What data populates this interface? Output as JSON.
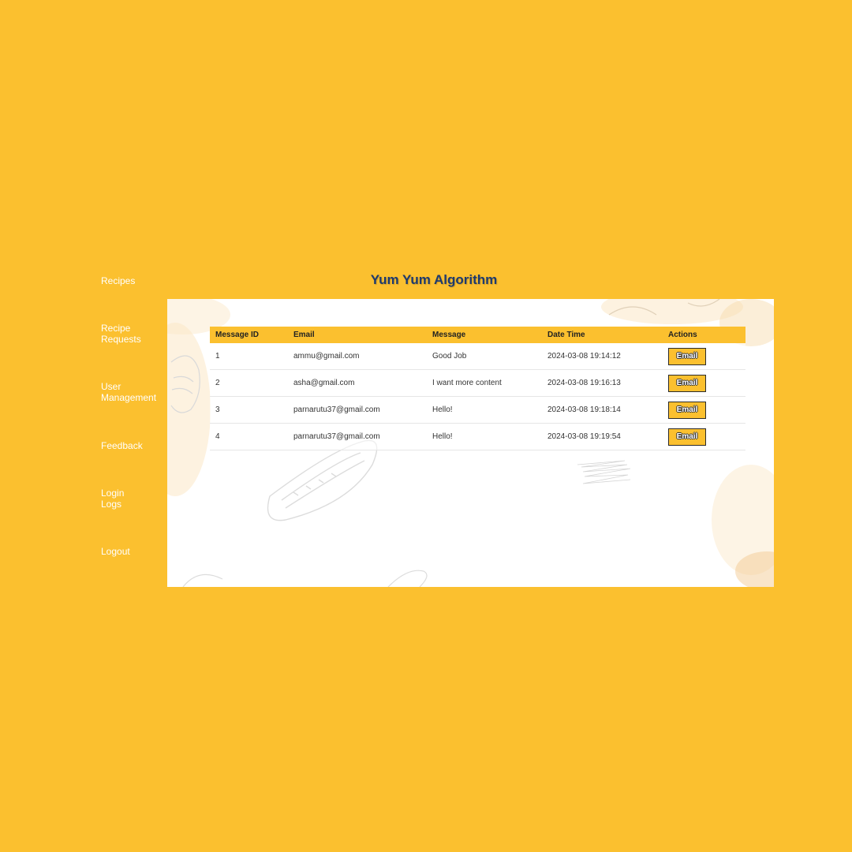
{
  "app": {
    "title": "Yum Yum Algorithm"
  },
  "sidebar": {
    "items": [
      {
        "label": "Recipes"
      },
      {
        "label": "Recipe\nRequests"
      },
      {
        "label": "User\nManagement"
      },
      {
        "label": "Feedback"
      },
      {
        "label": "Login\nLogs"
      },
      {
        "label": "Logout"
      }
    ]
  },
  "table": {
    "headers": [
      "Message ID",
      "Email",
      "Message",
      "Date Time",
      "Actions"
    ],
    "rows": [
      {
        "id": "1",
        "email": "ammu@gmail.com",
        "message": "Good Job",
        "datetime": "2024-03-08 19:14:12",
        "action": "Email"
      },
      {
        "id": "2",
        "email": "asha@gmail.com",
        "message": "I want more content",
        "datetime": "2024-03-08 19:16:13",
        "action": "Email"
      },
      {
        "id": "3",
        "email": "parnarutu37@gmail.com",
        "message": "Hello!",
        "datetime": "2024-03-08 19:18:14",
        "action": "Email"
      },
      {
        "id": "4",
        "email": "parnarutu37@gmail.com",
        "message": "Hello!",
        "datetime": "2024-03-08 19:19:54",
        "action": "Email"
      }
    ]
  },
  "colors": {
    "background": "#FBC02F",
    "title": "#1e3a6e",
    "panel": "#ffffff"
  }
}
